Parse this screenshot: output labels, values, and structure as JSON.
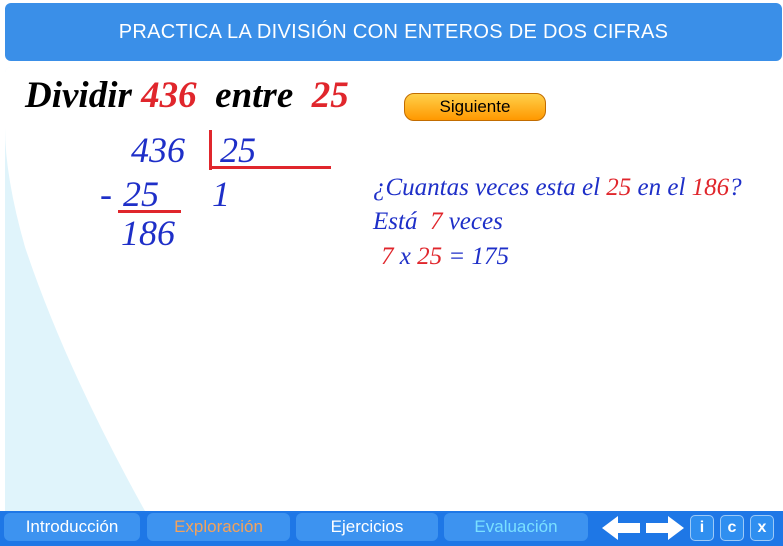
{
  "header": {
    "title": "PRACTICA LA DIVISIÓN CON ENTEROS DE DOS CIFRAS"
  },
  "problem": {
    "word_divide": "Dividir",
    "dividend": "436",
    "word_between": "entre",
    "divisor": "25"
  },
  "next_button": {
    "label": "Siguiente"
  },
  "division": {
    "dividend": "436",
    "divisor": "25",
    "quotient_digit": "1",
    "minus_sign": "-",
    "subtrahend": "25",
    "remainder": "186"
  },
  "question": {
    "prefix": "¿Cuantas veces esta el",
    "number_a": "25",
    "middle": "en el",
    "number_b": "186",
    "suffix": "?",
    "answer_prefix": "Está",
    "answer_times": "7",
    "answer_suffix": "veces",
    "calc_a": "7",
    "calc_op": "x",
    "calc_b": "25",
    "calc_eq": "=",
    "calc_result": "175"
  },
  "footer": {
    "tabs": [
      {
        "label": "Introducción",
        "color": "#ffffff"
      },
      {
        "label": "Exploración",
        "color": "#f4a25a"
      },
      {
        "label": "Ejercicios",
        "color": "#ffffff"
      },
      {
        "label": "Evaluación",
        "color": "#7ae0ff"
      }
    ],
    "prev_icon": "left-arrow-icon",
    "next_icon": "right-arrow-icon",
    "buttons": {
      "info": "i",
      "credits": "c",
      "close": "x"
    }
  },
  "colors": {
    "header_bg": "#3a8fe8",
    "footer_bg": "#1e77e6",
    "blue_text": "#1e2fc8",
    "red_text": "#e0262c",
    "panel_bg": "#e0f4fb"
  }
}
